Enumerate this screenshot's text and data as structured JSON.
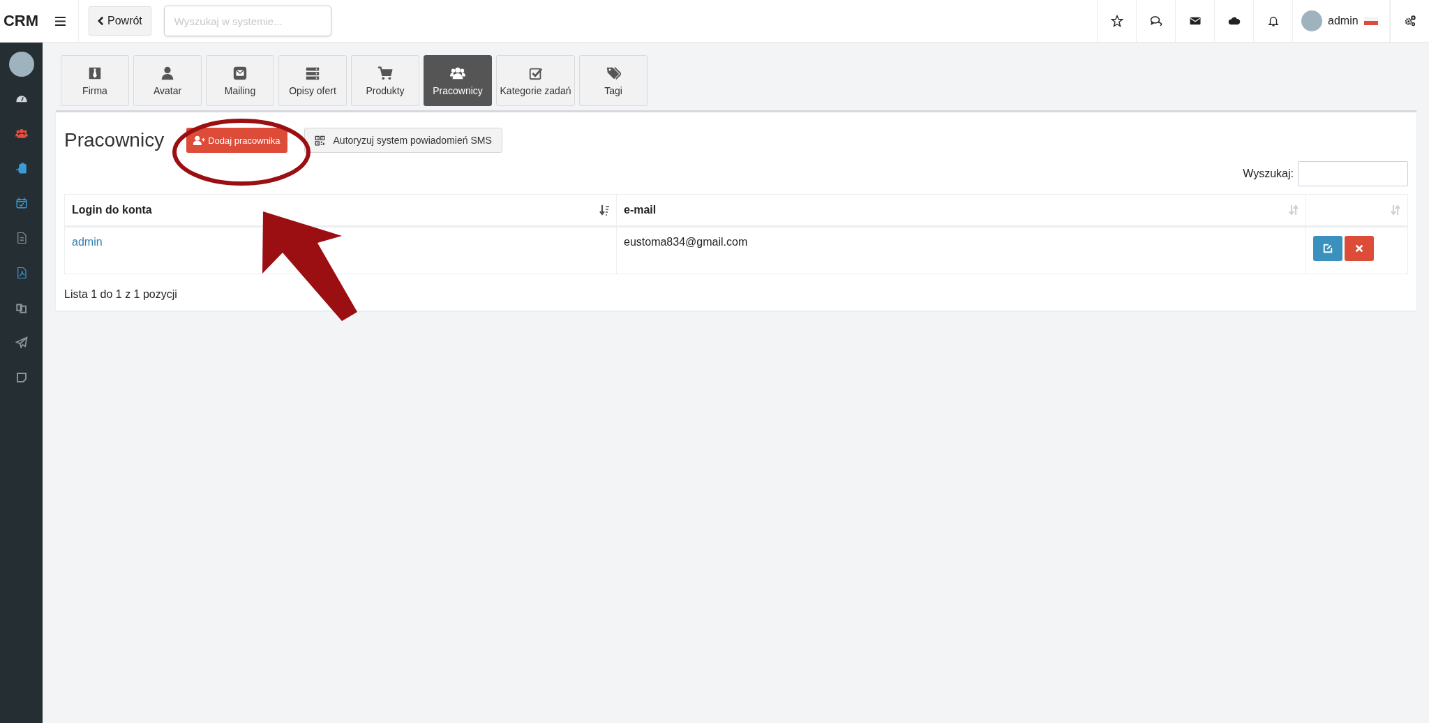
{
  "topbar": {
    "logo": "CRM",
    "back_button": "Powrót",
    "search": {
      "placeholder": "Wyszukaj w systemie..."
    },
    "user": "admin"
  },
  "sidebar": {
    "items": [
      {
        "color": "#d3d6d8"
      },
      {
        "color": "#e74c3c"
      },
      {
        "color": "#3c9ad6"
      },
      {
        "color": "#3c9ad6"
      },
      {
        "color": "#8d9397"
      },
      {
        "color": "#3c9ad6"
      },
      {
        "color": "#8d9397"
      },
      {
        "color": "#8d9397"
      },
      {
        "color": "#8d9397"
      }
    ]
  },
  "tabs": [
    {
      "label": "Firma",
      "selected": false
    },
    {
      "label": "Avatar",
      "selected": false
    },
    {
      "label": "Mailing",
      "selected": false
    },
    {
      "label": "Opisy ofert",
      "selected": false
    },
    {
      "label": "Produkty",
      "selected": false
    },
    {
      "label": "Pracownicy",
      "selected": true
    },
    {
      "label": "Kategorie zadań",
      "selected": false
    },
    {
      "label": "Tagi",
      "selected": false
    }
  ],
  "panel": {
    "title": "Pracownicy",
    "add_button": "Dodaj pracownika",
    "sms_button": "Autoryzuj system powiadomień SMS",
    "search_label": "Wyszukaj:",
    "table": {
      "columns": [
        {
          "label": "Login do konta",
          "sorted": true
        },
        {
          "label": "e-mail",
          "sorted": false
        },
        {
          "sorted": false
        }
      ],
      "rows": [
        {
          "login": "admin",
          "email": "eustoma834@gmail.com"
        }
      ]
    },
    "footer": "Lista 1 do 1 z 1 pozycji"
  }
}
